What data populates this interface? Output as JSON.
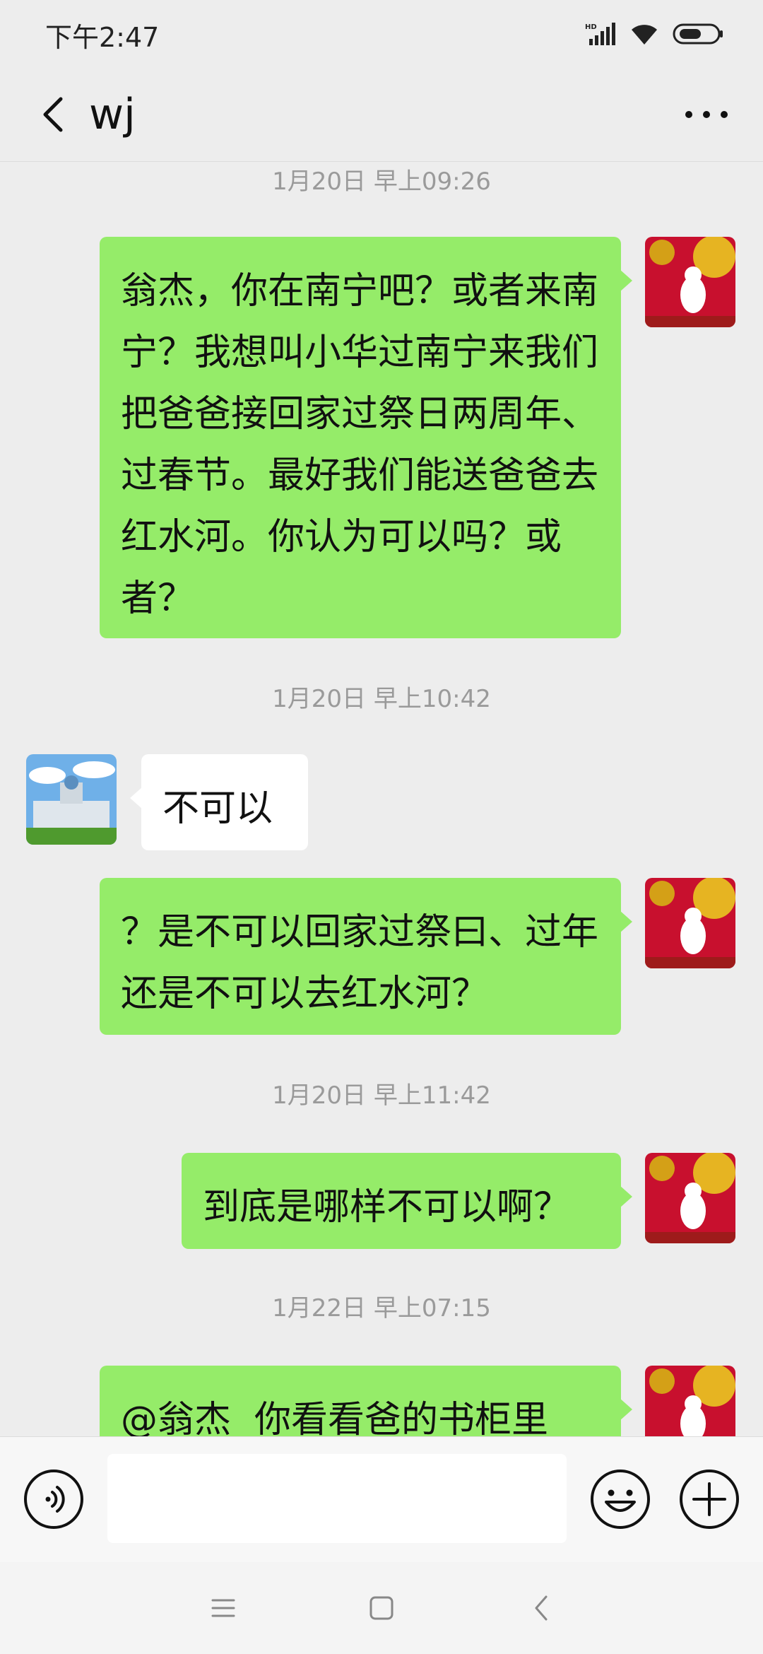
{
  "status_bar": {
    "time": "下午2:47",
    "hd_label": "HD"
  },
  "header": {
    "title": "wj"
  },
  "messages": [
    {
      "type": "timestamp",
      "text": "1月20日 早上09:26"
    },
    {
      "type": "message",
      "side": "me",
      "text": "翁杰，你在南宁吧？或者来南宁？我想叫小华过南宁来我们把爸爸接回家过祭日两周年、过春节。最好我们能送爸爸去红水河。你认为可以吗？或者？"
    },
    {
      "type": "timestamp",
      "text": "1月20日 早上10:42"
    },
    {
      "type": "message",
      "side": "other",
      "text": "不可以"
    },
    {
      "type": "message",
      "side": "me",
      "text": "？是不可以回家过祭曰、过年还是不可以去红水河？"
    },
    {
      "type": "timestamp",
      "text": "1月20日 早上11:42"
    },
    {
      "type": "message",
      "side": "me",
      "text": "到底是哪样不可以啊？"
    },
    {
      "type": "timestamp",
      "text": "1月22日 早上07:15"
    },
    {
      "type": "message",
      "side": "me",
      "text": "@翁杰  你看看爸的书柜里"
    }
  ],
  "input_bar": {
    "input_value": "",
    "voice_icon": "voice-icon",
    "emoji_icon": "emoji-icon",
    "plus_icon": "plus-icon"
  },
  "colors": {
    "my_bubble": "#95ec69",
    "other_bubble": "#ffffff",
    "background": "#ededed"
  }
}
